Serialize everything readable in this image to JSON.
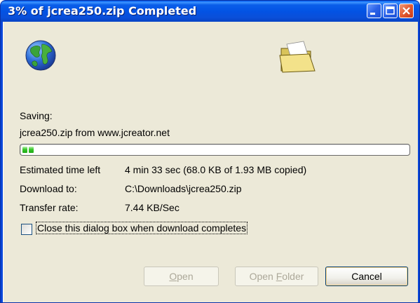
{
  "window": {
    "title": "3% of jcrea250.zip Completed"
  },
  "icons": {
    "globe": "globe-icon",
    "folder": "open-folder-icon",
    "minimize": "minimize-icon",
    "maximize": "maximize-icon",
    "close": "close-icon"
  },
  "status": {
    "saving_label": "Saving:",
    "saving_value": "jcrea250.zip from www.jcreator.net",
    "progress_percent": 3
  },
  "details": {
    "eta_label": "Estimated time left",
    "eta_value": "4 min 33 sec (68.0 KB of 1.93 MB copied)",
    "download_to_label": "Download to:",
    "download_to_value": "C:\\Downloads\\jcrea250.zip",
    "transfer_rate_label": "Transfer rate:",
    "transfer_rate_value": "7.44 KB/Sec"
  },
  "options": {
    "close_when_complete_label": "Close this dialog box when download completes",
    "close_when_complete_checked": false
  },
  "buttons": {
    "open_label": "Open",
    "open_folder_label": "Open Folder",
    "cancel_label": "Cancel"
  },
  "colors": {
    "titlebar_accent": "#0a5ee9",
    "progress_green": "#37c62a",
    "dialog_face": "#ece9d8"
  }
}
